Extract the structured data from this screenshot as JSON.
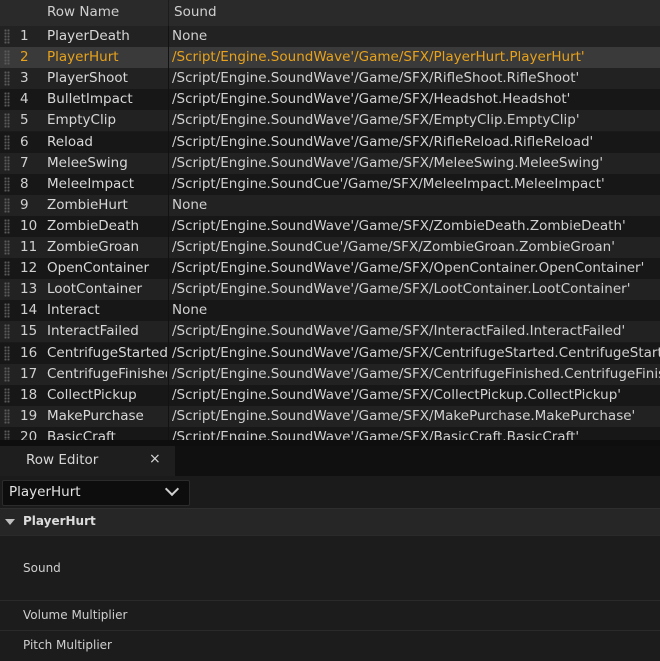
{
  "table": {
    "headers": {
      "name": "Row Name",
      "sound": "Sound"
    },
    "rows": [
      {
        "num": "1",
        "name": "PlayerDeath",
        "sound": "None"
      },
      {
        "num": "2",
        "name": "PlayerHurt",
        "sound": "/Script/Engine.SoundWave'/Game/SFX/PlayerHurt.PlayerHurt'"
      },
      {
        "num": "3",
        "name": "PlayerShoot",
        "sound": "/Script/Engine.SoundWave'/Game/SFX/RifleShoot.RifleShoot'"
      },
      {
        "num": "4",
        "name": "BulletImpact",
        "sound": "/Script/Engine.SoundWave'/Game/SFX/Headshot.Headshot'"
      },
      {
        "num": "5",
        "name": "EmptyClip",
        "sound": "/Script/Engine.SoundWave'/Game/SFX/EmptyClip.EmptyClip'"
      },
      {
        "num": "6",
        "name": "Reload",
        "sound": "/Script/Engine.SoundWave'/Game/SFX/RifleReload.RifleReload'"
      },
      {
        "num": "7",
        "name": "MeleeSwing",
        "sound": "/Script/Engine.SoundWave'/Game/SFX/MeleeSwing.MeleeSwing'"
      },
      {
        "num": "8",
        "name": "MeleeImpact",
        "sound": "/Script/Engine.SoundCue'/Game/SFX/MeleeImpact.MeleeImpact'"
      },
      {
        "num": "9",
        "name": "ZombieHurt",
        "sound": "None"
      },
      {
        "num": "10",
        "name": "ZombieDeath",
        "sound": "/Script/Engine.SoundWave'/Game/SFX/ZombieDeath.ZombieDeath'"
      },
      {
        "num": "11",
        "name": "ZombieGroan",
        "sound": "/Script/Engine.SoundCue'/Game/SFX/ZombieGroan.ZombieGroan'"
      },
      {
        "num": "12",
        "name": "OpenContainer",
        "sound": "/Script/Engine.SoundWave'/Game/SFX/OpenContainer.OpenContainer'"
      },
      {
        "num": "13",
        "name": "LootContainer",
        "sound": "/Script/Engine.SoundWave'/Game/SFX/LootContainer.LootContainer'"
      },
      {
        "num": "14",
        "name": "Interact",
        "sound": "None"
      },
      {
        "num": "15",
        "name": "InteractFailed",
        "sound": "/Script/Engine.SoundWave'/Game/SFX/InteractFailed.InteractFailed'"
      },
      {
        "num": "16",
        "name": "CentrifugeStarted",
        "sound": "/Script/Engine.SoundWave'/Game/SFX/CentrifugeStarted.CentrifugeStarted'"
      },
      {
        "num": "17",
        "name": "CentrifugeFinished",
        "sound": "/Script/Engine.SoundWave'/Game/SFX/CentrifugeFinished.CentrifugeFinished'"
      },
      {
        "num": "18",
        "name": "CollectPickup",
        "sound": "/Script/Engine.SoundWave'/Game/SFX/CollectPickup.CollectPickup'"
      },
      {
        "num": "19",
        "name": "MakePurchase",
        "sound": "/Script/Engine.SoundWave'/Game/SFX/MakePurchase.MakePurchase'"
      },
      {
        "num": "20",
        "name": "BasicCraft",
        "sound": "/Script/Engine.SoundWave'/Game/SFX/BasicCraft.BasicCraft'"
      }
    ],
    "selected_row": "2"
  },
  "row_editor": {
    "tab_label": "Row Editor",
    "close_glyph": "×",
    "selected_row_name": "PlayerHurt",
    "section_title": "PlayerHurt",
    "properties": [
      "Sound",
      "Volume Multiplier",
      "Pitch Multiplier"
    ]
  },
  "colors": {
    "selected_text": "#e8a21b",
    "background": "#1a1a1a"
  }
}
